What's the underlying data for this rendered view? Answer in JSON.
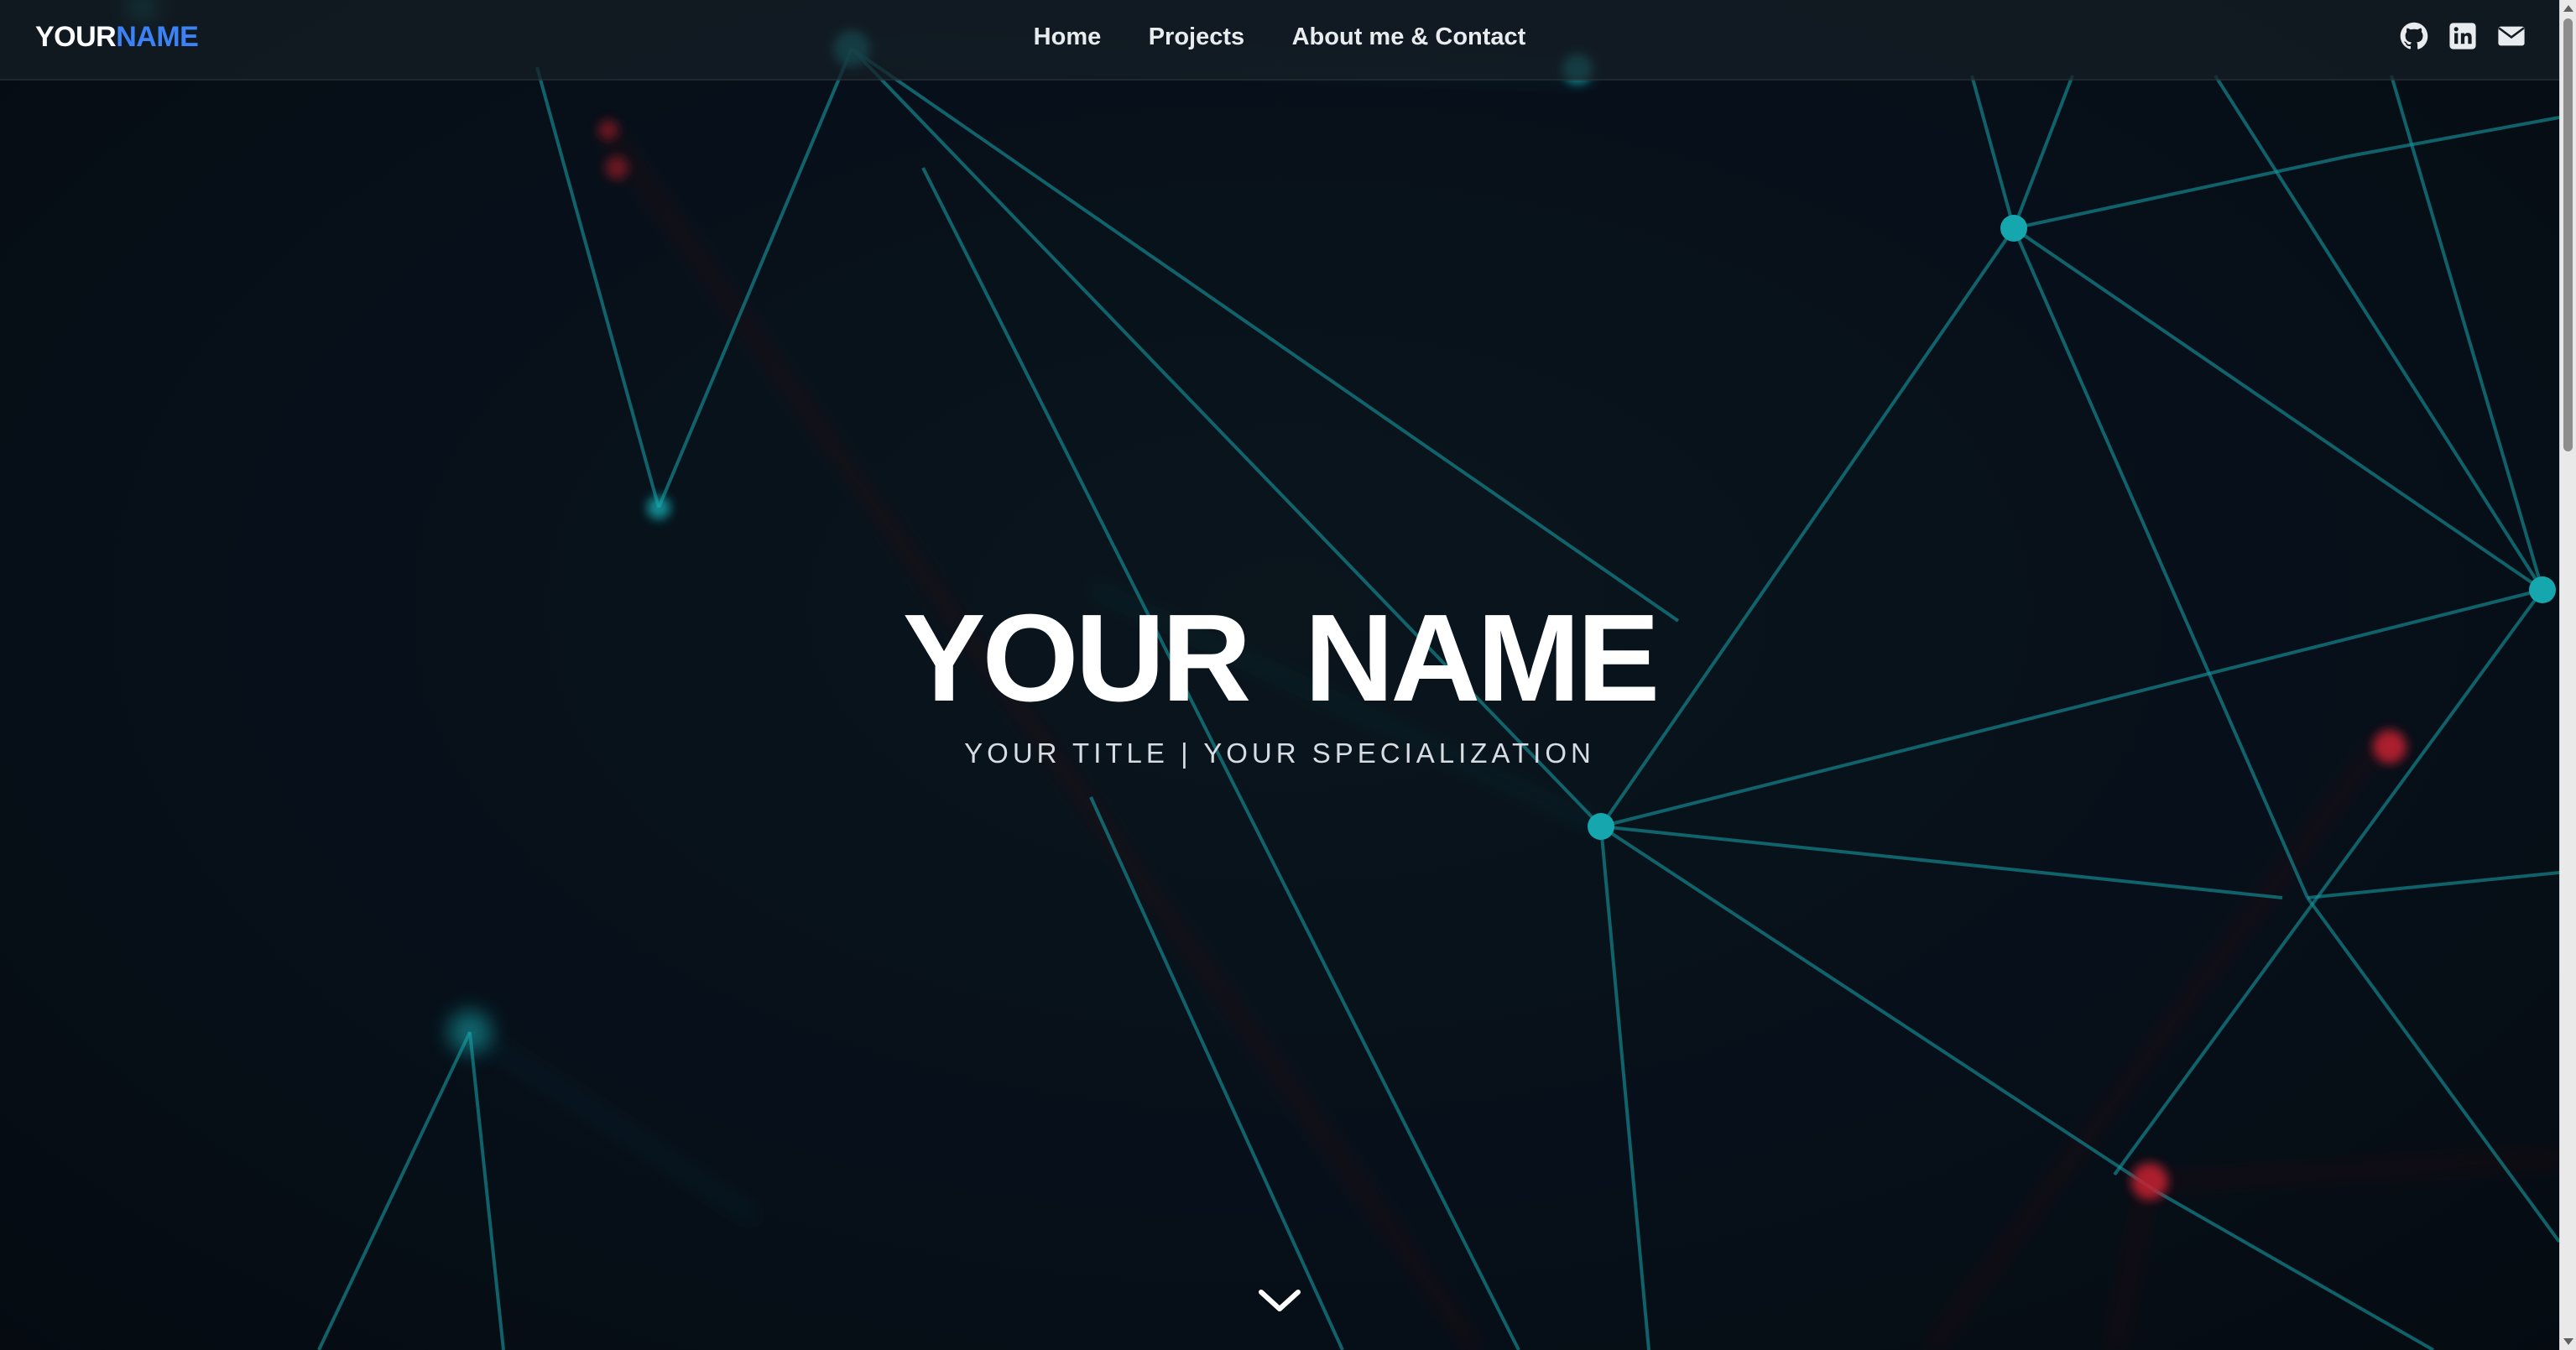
{
  "nav": {
    "brand_first": "YOUR",
    "brand_second": "NAME",
    "links": [
      "Home",
      "Projects",
      "About me & Contact"
    ],
    "social_icons": [
      "github-icon",
      "linkedin-icon",
      "envelope-icon"
    ]
  },
  "hero": {
    "name": "YOUR NAME",
    "subtitle": "YOUR TITLE | YOUR SPECIALIZATION",
    "scroll_icon": "chevron-down-icon"
  },
  "colors": {
    "background": "#070d13",
    "brand_accent": "#3b82f6",
    "network_teal": "#14a3a8",
    "network_red": "#c0202e",
    "text": "#ffffff"
  }
}
